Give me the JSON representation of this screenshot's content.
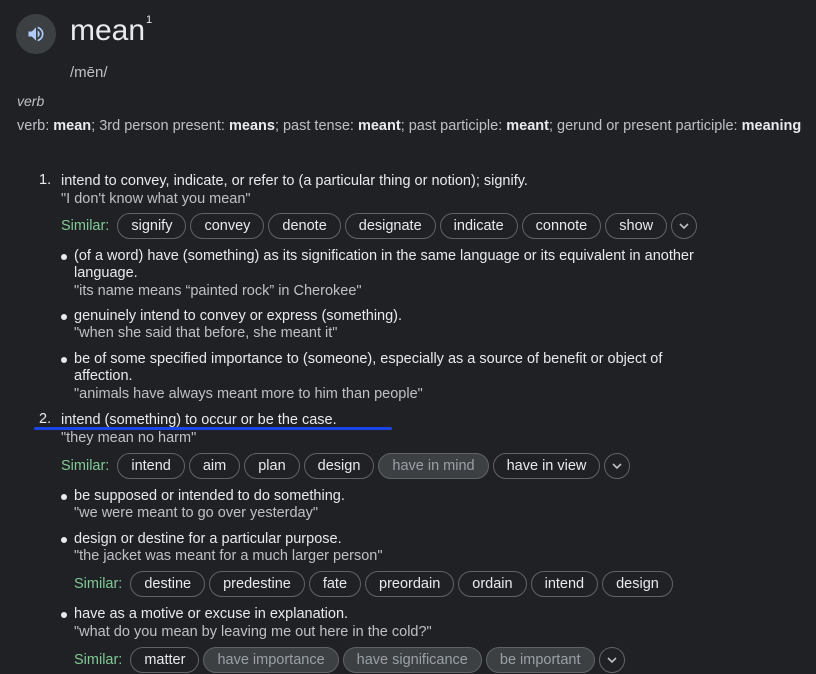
{
  "header": {
    "word": "mean",
    "sup": "1",
    "phonetic": "/mēn/"
  },
  "pos": "verb",
  "forms": [
    {
      "t": "verb: ",
      "b": false
    },
    {
      "t": "mean",
      "b": true
    },
    {
      "t": "; 3rd person present: ",
      "b": false
    },
    {
      "t": "means",
      "b": true
    },
    {
      "t": "; past tense: ",
      "b": false
    },
    {
      "t": "meant",
      "b": true
    },
    {
      "t": "; past participle: ",
      "b": false
    },
    {
      "t": "meant",
      "b": true
    },
    {
      "t": "; gerund or present participle: ",
      "b": false
    },
    {
      "t": "meaning",
      "b": true
    }
  ],
  "similar_label": "Similar:",
  "sense1": {
    "num": "1.",
    "def": "intend to convey, indicate, or refer to (a particular thing or notion); signify.",
    "example": "\"I don't know what you mean\"",
    "similar": [
      "signify",
      "convey",
      "denote",
      "designate",
      "indicate",
      "connote",
      "show"
    ],
    "subs": [
      {
        "def1": "(of a word) have (something) as its signification in the same language or its equivalent in another",
        "def2": "language.",
        "example": "\"its name means “painted rock” in Cherokee\""
      },
      {
        "def1": "genuinely intend to convey or express (something).",
        "example": "\"when she said that before, she meant it\""
      },
      {
        "def1": "be of some specified importance to (someone), especially as a source of benefit or object of",
        "def2": "affection.",
        "example": "\"animals have always meant more to him than people\""
      }
    ]
  },
  "sense2": {
    "num": "2.",
    "def": "intend (something) to occur or be the case.",
    "example": "\"they mean no harm\"",
    "similar": [
      "intend",
      "aim",
      "plan",
      "design",
      "have in mind",
      "have in view"
    ],
    "subs": [
      {
        "def1": "be supposed or intended to do something.",
        "example": "\"we were meant to go over yesterday\""
      },
      {
        "def1": "design or destine for a particular purpose.",
        "example": "\"the jacket was meant for a much larger person\"",
        "similar": [
          "destine",
          "predestine",
          "fate",
          "preordain",
          "ordain",
          "intend",
          "design"
        ]
      },
      {
        "def1": "have as a motive or excuse in explanation.",
        "example": "\"what do you mean by leaving me out here in the cold?\"",
        "similar": [
          "matter",
          "have importance",
          "have significance",
          "be important"
        ]
      }
    ]
  },
  "colors": {
    "background": "#202124",
    "similar_label": "#81c995",
    "annotation_underline": "#1a45e8"
  }
}
